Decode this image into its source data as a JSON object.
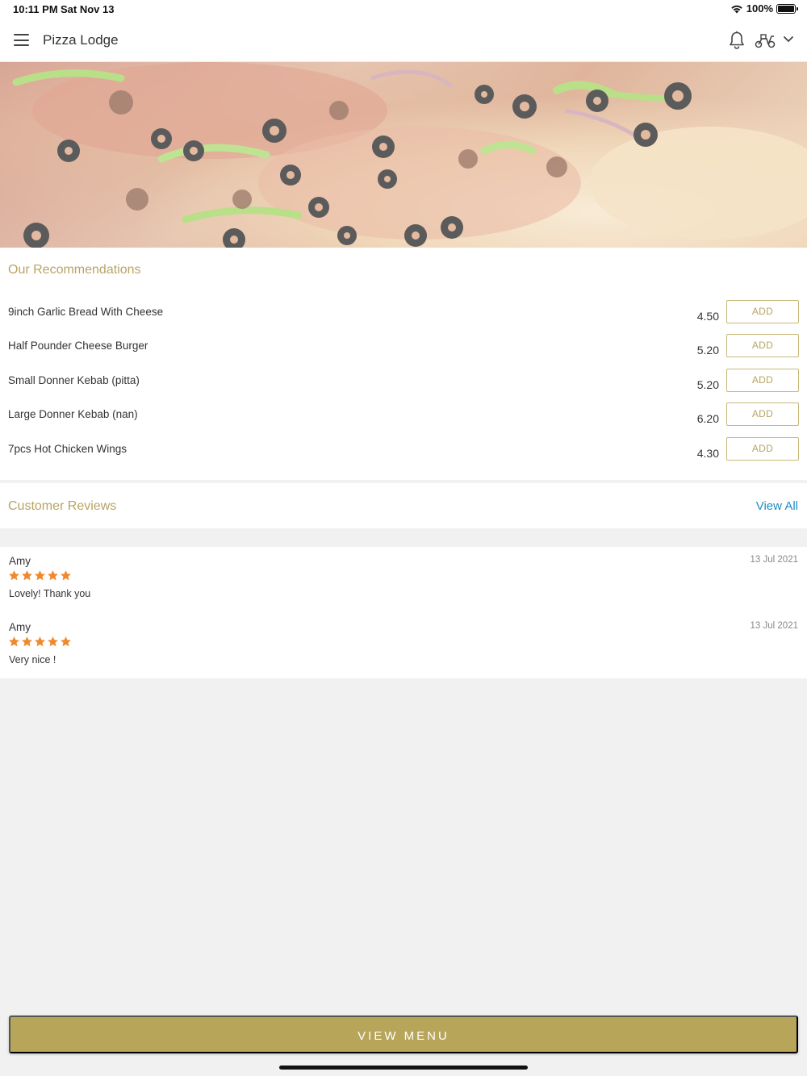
{
  "status_bar": {
    "time": "10:11 PM",
    "date": "Sat Nov 13",
    "battery": "100%"
  },
  "header": {
    "title": "Pizza Lodge"
  },
  "icons": {
    "menu": "menu-icon",
    "notifications": "bell-icon",
    "delivery": "scooter-icon",
    "dropdown": "chevron-down-icon"
  },
  "recommendations": {
    "title": "Our Recommendations",
    "items": [
      {
        "name": "9inch Garlic Bread With Cheese",
        "price": "4.50",
        "button": "ADD"
      },
      {
        "name": "Half Pounder Cheese Burger",
        "price": "5.20",
        "button": "ADD"
      },
      {
        "name": "Small Donner Kebab (pitta)",
        "price": "5.20",
        "button": "ADD"
      },
      {
        "name": "Large Donner Kebab (nan)",
        "price": "6.20",
        "button": "ADD"
      },
      {
        "name": "7pcs Hot Chicken Wings",
        "price": "4.30",
        "button": "ADD"
      }
    ]
  },
  "reviews": {
    "title": "Customer Reviews",
    "view_all": "View All",
    "items": [
      {
        "author": "Amy",
        "date": "13 Jul 2021",
        "rating": 5,
        "text": "Lovely! Thank you"
      },
      {
        "author": "Amy",
        "date": "13 Jul 2021",
        "rating": 5,
        "text": "Very nice !"
      }
    ]
  },
  "footer": {
    "view_menu": "VIEW MENU"
  },
  "colors": {
    "accent_gold": "#b7a559",
    "link_blue": "#1e8cc4",
    "star_orange": "#f0892d"
  }
}
